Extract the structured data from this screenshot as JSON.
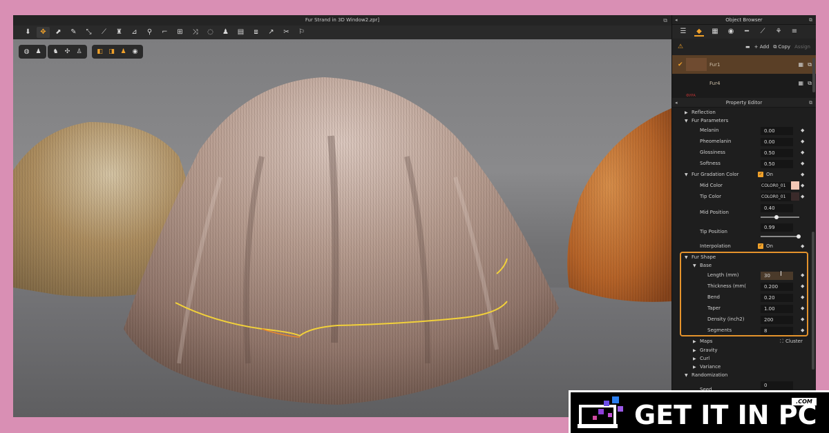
{
  "viewport_window": {
    "title": "Fur Strand in 3D Window2.zpr]",
    "toolbar_icons": [
      "move-down-icon",
      "move-arrows-icon",
      "select-icon",
      "edit-pattern-icon",
      "transform-icon",
      "draw-line-icon",
      "garment-icon",
      "ruler-icon",
      "pin-icon",
      "segment-icon",
      "grid-icon",
      "fold-icon",
      "circle-tool-icon",
      "mannequin-icon",
      "tag-icon",
      "sew-icon",
      "arrow-icon",
      "scissor-icon",
      "figure-icon"
    ],
    "view_icons_group1": [
      "globe-icon",
      "shirt-icon"
    ],
    "view_icons_group2": [
      "shirt-solid-icon",
      "sew-view-icon",
      "avatar-icon"
    ],
    "view_icons_group3": [
      "fabric-icon",
      "texture-icon",
      "avatar-light-icon",
      "sphere-icon"
    ]
  },
  "object_browser": {
    "title": "Object Browser",
    "tabs": [
      "list-icon",
      "fabric-icon",
      "pattern-icon",
      "sphere-icon",
      "line-icon",
      "pen-icon",
      "strand-icon"
    ],
    "add_label": "+ Add",
    "copy_label": "Copy",
    "assign_label": "Assign",
    "items": [
      {
        "name": "Fur1",
        "selected": true
      },
      {
        "name": "Fur4",
        "selected": false
      }
    ],
    "footer_note": "ФУРА"
  },
  "property_editor": {
    "title": "Property Editor",
    "reflection_label": "Reflection",
    "fur_parameters": {
      "label": "Fur Parameters",
      "melanin": {
        "label": "Melanin",
        "value": "0.00"
      },
      "pheomelanin": {
        "label": "Pheomelanin",
        "value": "0.00"
      },
      "glossiness": {
        "label": "Glossiness",
        "value": "0.50"
      },
      "softness": {
        "label": "Softness",
        "value": "0.50"
      }
    },
    "gradation": {
      "label": "Fur Gradation Color",
      "toggle": "On",
      "mid_color": {
        "label": "Mid Color",
        "value": "COLOR0_01"
      },
      "tip_color": {
        "label": "Tip Color",
        "value": "COLOR0_01"
      },
      "mid_position": {
        "label": "Mid Position",
        "value": "0.40",
        "fill": 0.4
      },
      "tip_position": {
        "label": "Tip Position",
        "value": "0.99",
        "fill": 0.99
      },
      "interpolation": {
        "label": "Interpolation",
        "value": "On"
      }
    },
    "fur_shape": {
      "label": "Fur Shape",
      "base_label": "Base",
      "length": {
        "label": "Length (mm)",
        "value": "30"
      },
      "thickness": {
        "label": "Thickness (mm(",
        "value": "0.200"
      },
      "bend": {
        "label": "Bend",
        "value": "0.20"
      },
      "taper": {
        "label": "Taper",
        "value": "1.00"
      },
      "density": {
        "label": "Density (inch2)",
        "value": "200"
      },
      "segments": {
        "label": "Segments",
        "value": "8"
      },
      "maps_label": "Maps",
      "cluster_label": "Cluster",
      "gravity_label": "Gravity",
      "curl_label": "Curl",
      "variance_label": "Variance"
    },
    "randomization": {
      "label": "Randomization",
      "seed": {
        "label": "Seed",
        "value": "0"
      }
    }
  },
  "watermark": {
    "text": "GET IT IN PC",
    "com": ".COM"
  },
  "colors": {
    "accent": "#f0a12a",
    "selection": "#5a3f26",
    "mid_color_chip": "#f2c7b5",
    "tip_color_chip": "#3a2a2a",
    "page_bg": "#d98fb4"
  }
}
